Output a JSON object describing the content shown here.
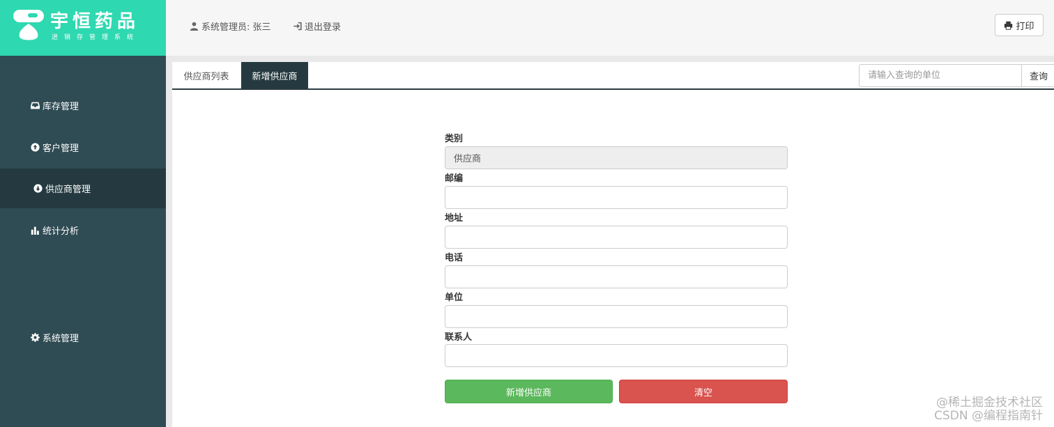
{
  "logo": {
    "title": "宇恒药品",
    "subtitle": "进销存管理系统"
  },
  "header": {
    "user_text": "系统管理员: 张三",
    "logout_label": "退出登录",
    "print_label": "打印"
  },
  "sidebar": {
    "items": [
      {
        "label": "库存管理",
        "icon": "inbox-icon"
      },
      {
        "label": "客户管理",
        "icon": "circle-arrow-up-icon"
      },
      {
        "label": "供应商管理",
        "icon": "circle-arrow-down-icon",
        "active": true
      },
      {
        "label": "统计分析",
        "icon": "bar-chart-icon"
      },
      {
        "label": "系统管理",
        "icon": "gear-icon"
      }
    ]
  },
  "tabs": [
    {
      "label": "供应商列表"
    },
    {
      "label": "新增供应商",
      "active": true
    }
  ],
  "search": {
    "placeholder": "请输入查询的单位",
    "button_label": "查询"
  },
  "form": {
    "category": {
      "label": "类别",
      "value": "供应商"
    },
    "postcode": {
      "label": "邮编",
      "value": ""
    },
    "address": {
      "label": "地址",
      "value": ""
    },
    "phone": {
      "label": "电话",
      "value": ""
    },
    "unit": {
      "label": "单位",
      "value": ""
    },
    "contact": {
      "label": "联系人",
      "value": ""
    },
    "submit_label": "新增供应商",
    "clear_label": "清空"
  },
  "watermark": {
    "line1": "@稀土掘金技术社区",
    "line2": "CSDN @编程指南针"
  },
  "colors": {
    "logo_bg": "#2ed8b0",
    "sidebar_bg": "#2f4b53",
    "sidebar_active": "#243a40",
    "tab_active": "#253a40",
    "success": "#5cb85c",
    "danger": "#d9534f"
  }
}
